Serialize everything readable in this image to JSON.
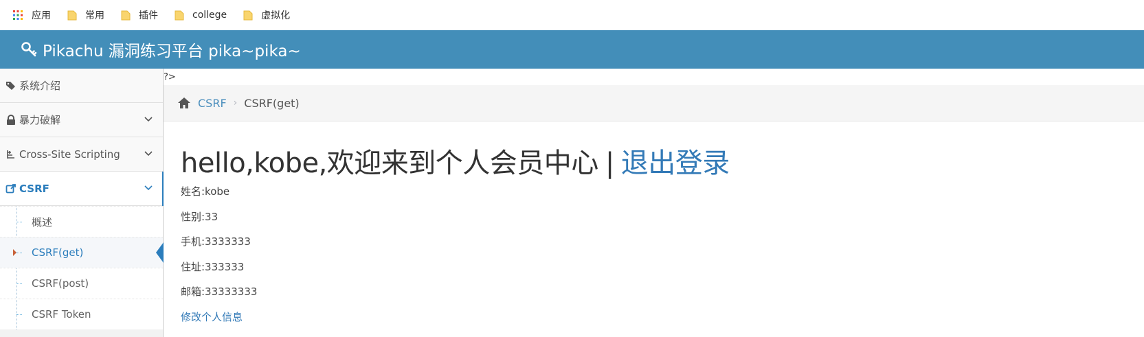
{
  "bookmarks": [
    {
      "label": "应用",
      "icon": "apps-grid-icon"
    },
    {
      "label": "常用",
      "icon": "folder-icon"
    },
    {
      "label": "插件",
      "icon": "folder-icon"
    },
    {
      "label": "college",
      "icon": "folder-icon"
    },
    {
      "label": "虚拟化",
      "icon": "folder-icon"
    }
  ],
  "navbar": {
    "title": "Pikachu 漏洞练习平台 pika~pika~",
    "bg": "#438eb9"
  },
  "sidebar": {
    "items": [
      {
        "label": "系统介绍",
        "icon": "tags-icon"
      },
      {
        "label": "暴力破解",
        "icon": "lock-icon"
      },
      {
        "label": "Cross-Site Scripting",
        "icon": "xss-icon"
      },
      {
        "label": "CSRF",
        "icon": "external-link-icon"
      }
    ],
    "submenu": [
      "概述",
      "CSRF(get)",
      "CSRF(post)",
      "CSRF Token"
    ]
  },
  "stray_text": "?>",
  "breadcrumb": {
    "link": "CSRF",
    "separator": "›",
    "current": "CSRF(get)"
  },
  "main": {
    "greeting": "hello,kobe,欢迎来到个人会员中心",
    "divider": "|",
    "logout": "退出登录",
    "fields": [
      "姓名:kobe",
      "性别:33",
      "手机:3333333",
      "住址:333333",
      "邮箱:33333333"
    ],
    "edit_link": "修改个人信息"
  },
  "colors": {
    "accent": "#2b7dbc",
    "link": "#337ab7"
  }
}
